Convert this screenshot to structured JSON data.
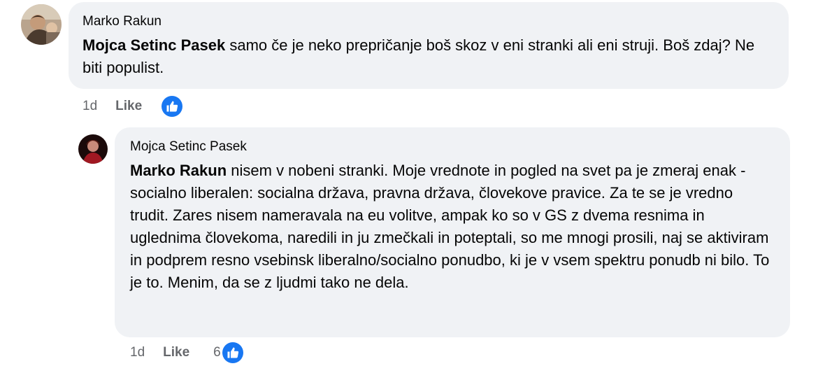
{
  "comments": [
    {
      "author": "Marko Rakun",
      "mention": "Mojca Setinc Pasek",
      "text": " samo če je neko prepričanje boš skoz v eni stranki ali eni struji. Boš zdaj? Ne biti populist.",
      "time": "1d",
      "like_label": "Like",
      "reaction_count": ""
    },
    {
      "author": "Mojca Setinc Pasek",
      "mention": "Marko Rakun",
      "text": " nisem v nobeni stranki. Moje vrednote in pogled na svet pa je zmeraj enak - socialno liberalen: socialna država, pravna država, človekove pravice. Za te se je vredno trudit. Zares nisem nameravala na eu volitve, ampak ko so v GS z dvema resnima in uglednima človekoma, naredili in ju zmečkali in poteptali, so me mnogi prosili, naj se aktiviram in podprem resno vsebinsk liberalno/socialno ponudbo, ki je v vsem spektru ponudb ni bilo. To je to. Menim, da se z ljudmi tako ne dela.",
      "time": "1d",
      "like_label": "Like",
      "reaction_count": "6"
    }
  ],
  "icons": {
    "reaction": "thumbs-up-icon"
  },
  "colors": {
    "accent": "#1877f2",
    "bubble": "#f0f2f5",
    "meta": "#65676b"
  }
}
